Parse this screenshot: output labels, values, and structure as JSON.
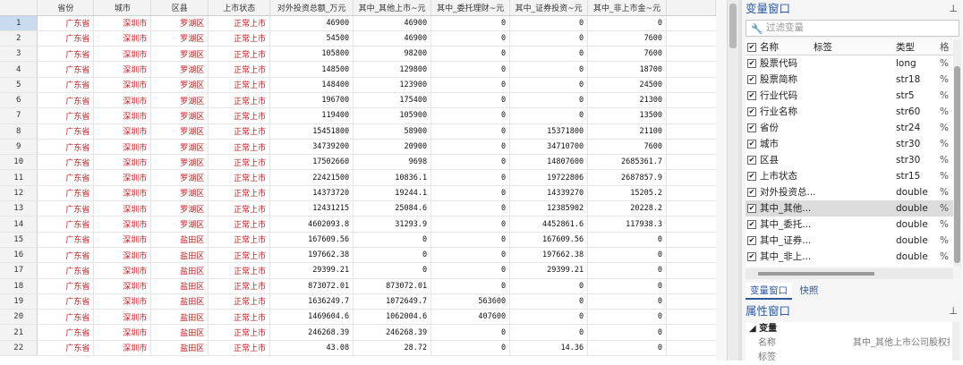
{
  "grid": {
    "headers": [
      "省份",
      "城市",
      "区县",
      "上市状态",
      "对外投资总额_万元",
      "其中_其他上市~元",
      "其中_委托理财~元",
      "其中_证券投资~元",
      "其中_非上市金~元"
    ],
    "rows": [
      [
        "1",
        "广东省",
        "深圳市",
        "罗湖区",
        "正常上市",
        "46900",
        "46900",
        "0",
        "0",
        "0"
      ],
      [
        "2",
        "广东省",
        "深圳市",
        "罗湖区",
        "正常上市",
        "54500",
        "46900",
        "0",
        "0",
        "7600"
      ],
      [
        "3",
        "广东省",
        "深圳市",
        "罗湖区",
        "正常上市",
        "105800",
        "98200",
        "0",
        "0",
        "7600"
      ],
      [
        "4",
        "广东省",
        "深圳市",
        "罗湖区",
        "正常上市",
        "148500",
        "129800",
        "0",
        "0",
        "18700"
      ],
      [
        "5",
        "广东省",
        "深圳市",
        "罗湖区",
        "正常上市",
        "148400",
        "123900",
        "0",
        "0",
        "24500"
      ],
      [
        "6",
        "广东省",
        "深圳市",
        "罗湖区",
        "正常上市",
        "196700",
        "175400",
        "0",
        "0",
        "21300"
      ],
      [
        "7",
        "广东省",
        "深圳市",
        "罗湖区",
        "正常上市",
        "119400",
        "105900",
        "0",
        "0",
        "13500"
      ],
      [
        "8",
        "广东省",
        "深圳市",
        "罗湖区",
        "正常上市",
        "15451800",
        "58900",
        "0",
        "15371800",
        "21100"
      ],
      [
        "9",
        "广东省",
        "深圳市",
        "罗湖区",
        "正常上市",
        "34739200",
        "20900",
        "0",
        "34710700",
        "7600"
      ],
      [
        "10",
        "广东省",
        "深圳市",
        "罗湖区",
        "正常上市",
        "17502660",
        "9698",
        "0",
        "14807600",
        "2685361.7"
      ],
      [
        "11",
        "广东省",
        "深圳市",
        "罗湖区",
        "正常上市",
        "22421500",
        "10836.1",
        "0",
        "19722806",
        "2687857.9"
      ],
      [
        "12",
        "广东省",
        "深圳市",
        "罗湖区",
        "正常上市",
        "14373720",
        "19244.1",
        "0",
        "14339270",
        "15205.2"
      ],
      [
        "13",
        "广东省",
        "深圳市",
        "罗湖区",
        "正常上市",
        "12431215",
        "25084.6",
        "0",
        "12385902",
        "20228.2"
      ],
      [
        "14",
        "广东省",
        "深圳市",
        "罗湖区",
        "正常上市",
        "4602093.8",
        "31293.9",
        "0",
        "4452861.6",
        "117938.3"
      ],
      [
        "15",
        "广东省",
        "深圳市",
        "盐田区",
        "正常上市",
        "167609.56",
        "0",
        "0",
        "167609.56",
        "0"
      ],
      [
        "16",
        "广东省",
        "深圳市",
        "盐田区",
        "正常上市",
        "197662.38",
        "0",
        "0",
        "197662.38",
        "0"
      ],
      [
        "17",
        "广东省",
        "深圳市",
        "盐田区",
        "正常上市",
        "29399.21",
        "0",
        "0",
        "29399.21",
        "0"
      ],
      [
        "18",
        "广东省",
        "深圳市",
        "盐田区",
        "正常上市",
        "873072.01",
        "873072.01",
        "0",
        "0",
        "0"
      ],
      [
        "19",
        "广东省",
        "深圳市",
        "盐田区",
        "正常上市",
        "1636249.7",
        "1072649.7",
        "563600",
        "0",
        "0"
      ],
      [
        "20",
        "广东省",
        "深圳市",
        "盐田区",
        "正常上市",
        "1469604.6",
        "1062004.6",
        "407600",
        "0",
        "0"
      ],
      [
        "21",
        "广东省",
        "深圳市",
        "盐田区",
        "正常上市",
        "246268.39",
        "246268.39",
        "0",
        "0",
        "0"
      ],
      [
        "22",
        "广东省",
        "深圳市",
        "盐田区",
        "正常上市",
        "43.08",
        "28.72",
        "0",
        "14.36",
        "0"
      ]
    ]
  },
  "var_window": {
    "title": "变量窗口",
    "pin": "ᵽ",
    "filter_placeholder": "过滤变量",
    "columns": {
      "name": "名称",
      "label": "标签",
      "type": "类型",
      "format": "格"
    },
    "items": [
      {
        "name": "股票代码",
        "type": "long",
        "fmt": "%"
      },
      {
        "name": "股票简称",
        "type": "str18",
        "fmt": "%"
      },
      {
        "name": "行业代码",
        "type": "str5",
        "fmt": "%"
      },
      {
        "name": "行业名称",
        "type": "str60",
        "fmt": "%"
      },
      {
        "name": "省份",
        "type": "str24",
        "fmt": "%"
      },
      {
        "name": "城市",
        "type": "str30",
        "fmt": "%"
      },
      {
        "name": "区县",
        "type": "str30",
        "fmt": "%"
      },
      {
        "name": "上市状态",
        "type": "str15",
        "fmt": "%"
      },
      {
        "name": "对外投资总...",
        "type": "double",
        "fmt": "%"
      },
      {
        "name": "其中_其他...",
        "type": "double",
        "fmt": "%"
      },
      {
        "name": "其中_委托...",
        "type": "double",
        "fmt": "%"
      },
      {
        "name": "其中_证券...",
        "type": "double",
        "fmt": "%"
      },
      {
        "name": "其中_非上...",
        "type": "double",
        "fmt": "%"
      }
    ],
    "tabs": [
      "变量窗口",
      "快照"
    ]
  },
  "prop_window": {
    "title": "属性窗口",
    "pin": "ᵽ",
    "group": "变量",
    "rows": [
      {
        "key": "名称",
        "value": "其中_其他上市公司股权投"
      },
      {
        "key": "标签",
        "value": ""
      }
    ]
  }
}
